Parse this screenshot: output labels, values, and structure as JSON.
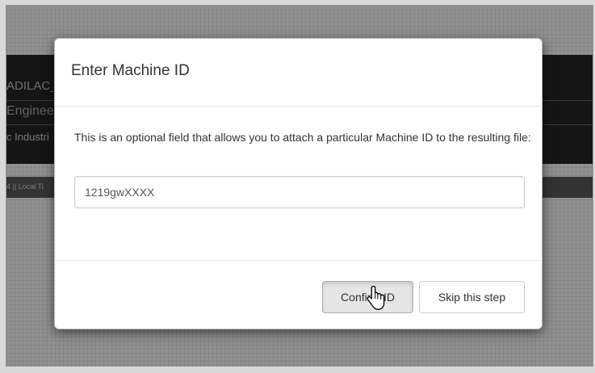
{
  "background_app": {
    "header_line_1": "ADILAC_",
    "header_line_2": "Enginee",
    "header_line_3": "c Industri",
    "status_bar_text": "4 || Local Ti"
  },
  "modal": {
    "title": "Enter Machine ID",
    "description": "This is an optional field that allows you to attach a particular Machine ID to the resulting file:",
    "machine_id_input": {
      "value": "1219gwXXXX",
      "placeholder": ""
    },
    "buttons": {
      "confirm_label": "Confirm ID",
      "skip_label": "Skip this step"
    }
  },
  "icons": {
    "cursor": "hand-pointer-icon"
  },
  "colors": {
    "dialog_background": "#ffffff",
    "header_background": "#1e1e1e",
    "overlay_background": "#c9c9c9",
    "text": "#333333",
    "button_active_background": "#e6e6e6"
  }
}
